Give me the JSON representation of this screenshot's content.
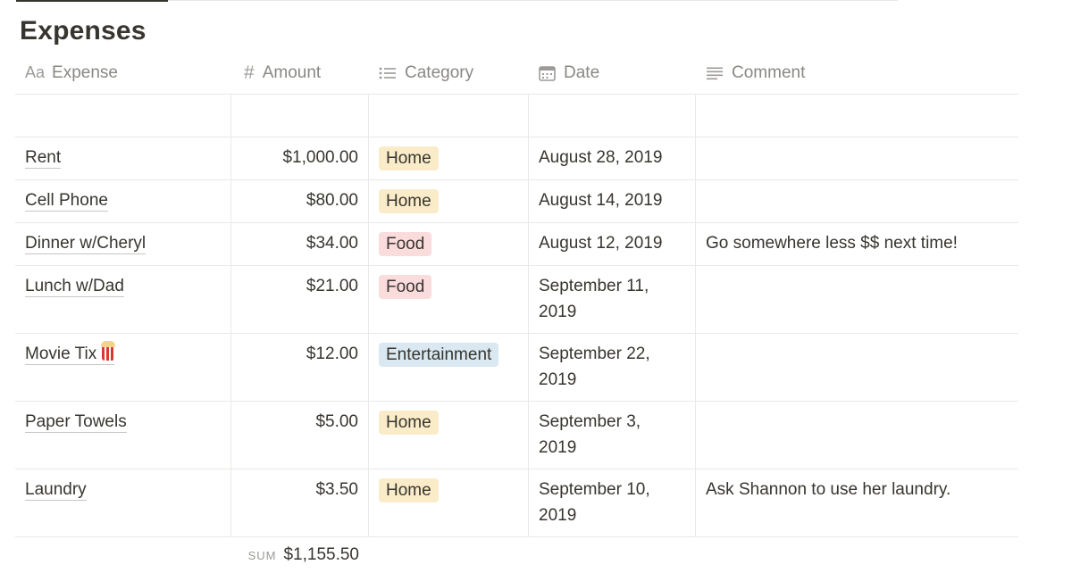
{
  "page": {
    "title": "Expenses"
  },
  "columns": [
    {
      "label": "Expense",
      "icon": "title-aa-icon",
      "icon_text": "Aa"
    },
    {
      "label": "Amount",
      "icon": "number-hash-icon",
      "icon_text": "#"
    },
    {
      "label": "Category",
      "icon": "list-icon",
      "icon_text": ""
    },
    {
      "label": "Date",
      "icon": "calendar-icon",
      "icon_text": ""
    },
    {
      "label": "Comment",
      "icon": "text-lines-icon",
      "icon_text": ""
    }
  ],
  "rows": [
    {
      "expense": "Rent",
      "amount": "$1,000.00",
      "category": "Home",
      "date": "August 28, 2019",
      "comment": ""
    },
    {
      "expense": "Cell Phone",
      "amount": "$80.00",
      "category": "Home",
      "date": "August 14, 2019",
      "comment": ""
    },
    {
      "expense": "Dinner w/Cheryl",
      "amount": "$34.00",
      "category": "Food",
      "date": "August 12, 2019",
      "comment": "Go somewhere less $$ next time!"
    },
    {
      "expense": "Lunch w/Dad",
      "amount": "$21.00",
      "category": "Food",
      "date": "September 11, 2019",
      "comment": ""
    },
    {
      "expense": "Movie Tix",
      "amount": "$12.00",
      "category": "Entertainment",
      "date": "September 22, 2019",
      "comment": "",
      "emoji": "popcorn-icon"
    },
    {
      "expense": "Paper Towels",
      "amount": "$5.00",
      "category": "Home",
      "date": "September 3, 2019",
      "comment": ""
    },
    {
      "expense": "Laundry",
      "amount": "$3.50",
      "category": "Home",
      "date": "September 10, 2019",
      "comment": "Ask Shannon to use her laundry."
    }
  ],
  "category_colors": {
    "Home": {
      "bg": "#fbecc9",
      "fg": "#37352f"
    },
    "Food": {
      "bg": "#fbdcdc",
      "fg": "#37352f"
    },
    "Entertainment": {
      "bg": "#d9e8f1",
      "fg": "#37352f"
    }
  },
  "footer": {
    "sum_label": "SUM",
    "sum_value": "$1,155.50"
  }
}
